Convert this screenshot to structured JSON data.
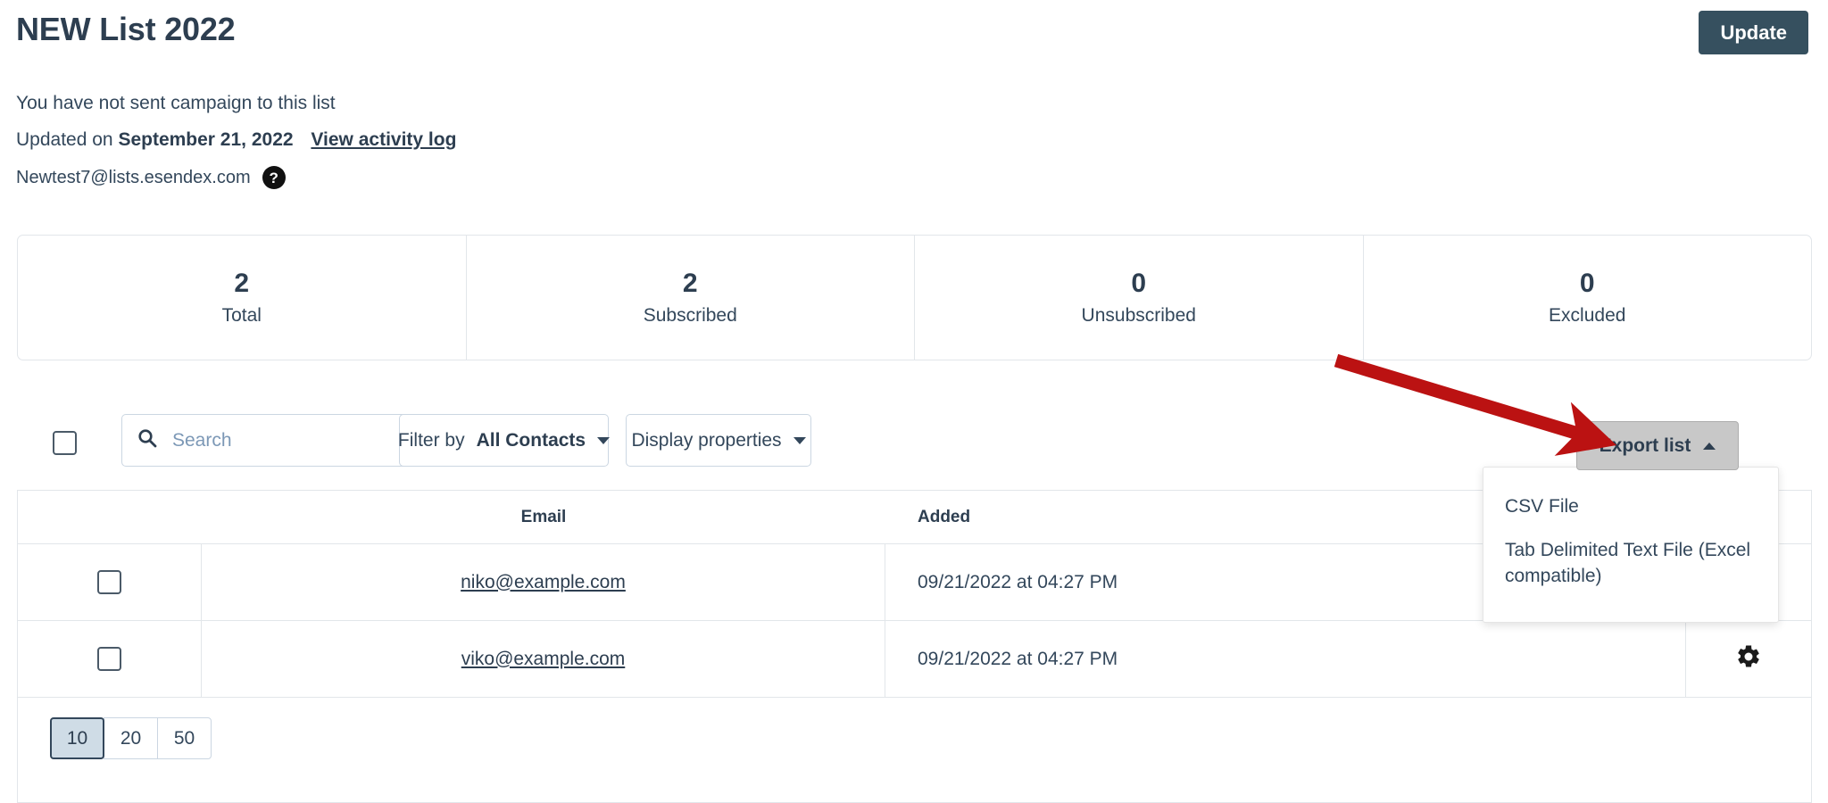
{
  "header": {
    "title": "NEW List 2022",
    "update_button": "Update",
    "campaign_note": "You have not sent campaign to this list",
    "updated_prefix": "Updated on",
    "updated_date": "September 21, 2022",
    "activity_link": "View activity log",
    "list_email": "Newtest7@lists.esendex.com",
    "help_icon_glyph": "?"
  },
  "stats": [
    {
      "value": "2",
      "label": "Total"
    },
    {
      "value": "2",
      "label": "Subscribed"
    },
    {
      "value": "0",
      "label": "Unsubscribed"
    },
    {
      "value": "0",
      "label": "Excluded"
    }
  ],
  "toolbar": {
    "select_all_name": "select-all-checkbox",
    "search": {
      "placeholder": "Search",
      "value": "",
      "icon": "search-icon"
    },
    "filter_prefix": "Filter by",
    "filter_value": "All Contacts",
    "display_properties": "Display properties",
    "export_button": "Export list",
    "export_menu": [
      "CSV File",
      "Tab Delimited Text File (Excel compatible)"
    ]
  },
  "table": {
    "columns": [
      "",
      "Email",
      "Added",
      ""
    ],
    "rows": [
      {
        "email": "niko@example.com",
        "added": "09/21/2022 at 04:27 PM",
        "gear": false
      },
      {
        "email": "viko@example.com",
        "added": "09/21/2022 at 04:27 PM",
        "gear": true
      }
    ]
  },
  "pagination": {
    "options": [
      "10",
      "20",
      "50"
    ],
    "selected": "10"
  },
  "annotation": {
    "arrow_color": "#bb1212"
  },
  "colors": {
    "accent": "#36505f",
    "text": "#33475b",
    "heading": "#2d3e50",
    "border": "#e2e6ea",
    "input_border": "#cbd6e2",
    "export_bg": "#c8c8c8",
    "pager_active_bg": "#cfdce6",
    "arrow": "#bb1212"
  }
}
